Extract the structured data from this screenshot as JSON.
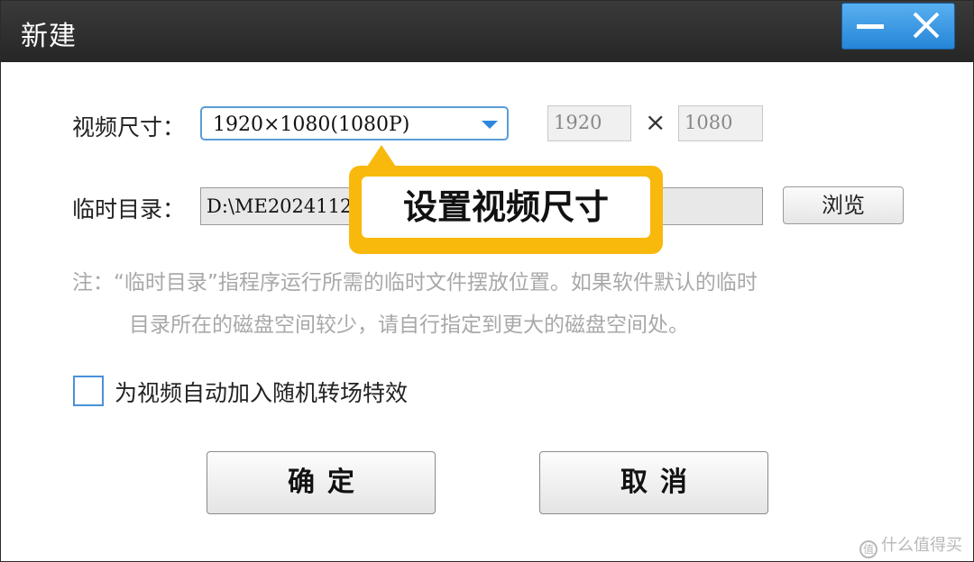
{
  "window": {
    "title": "新建",
    "minimize_glyph": "−",
    "close_glyph": "✕"
  },
  "video_size": {
    "label": "视频尺寸：",
    "selected": "1920×1080(1080P)",
    "width": "1920",
    "times": "×",
    "height": "1080"
  },
  "temp_dir": {
    "label": "临时目录：",
    "value": "D:\\ME2024112",
    "browse_label": "浏览"
  },
  "note": {
    "line1": "注：“临时目录”指程序运行所需的临时文件摆放位置。如果软件默认的临时",
    "line2": "目录所在的磁盘空间较少，请自行指定到更大的磁盘空间处。"
  },
  "transition": {
    "checked": false,
    "label": "为视频自动加入随机转场特效"
  },
  "buttons": {
    "ok": "确定",
    "cancel": "取消"
  },
  "callout": {
    "text": "设置视频尺寸"
  },
  "watermark": {
    "icon": "值",
    "text": "什么值得买"
  },
  "colors": {
    "titlebar": "#2e2e2e",
    "window_buttons": "#2e8ee0",
    "accent_border": "#5b9bd5",
    "callout": "#f8b90c"
  }
}
